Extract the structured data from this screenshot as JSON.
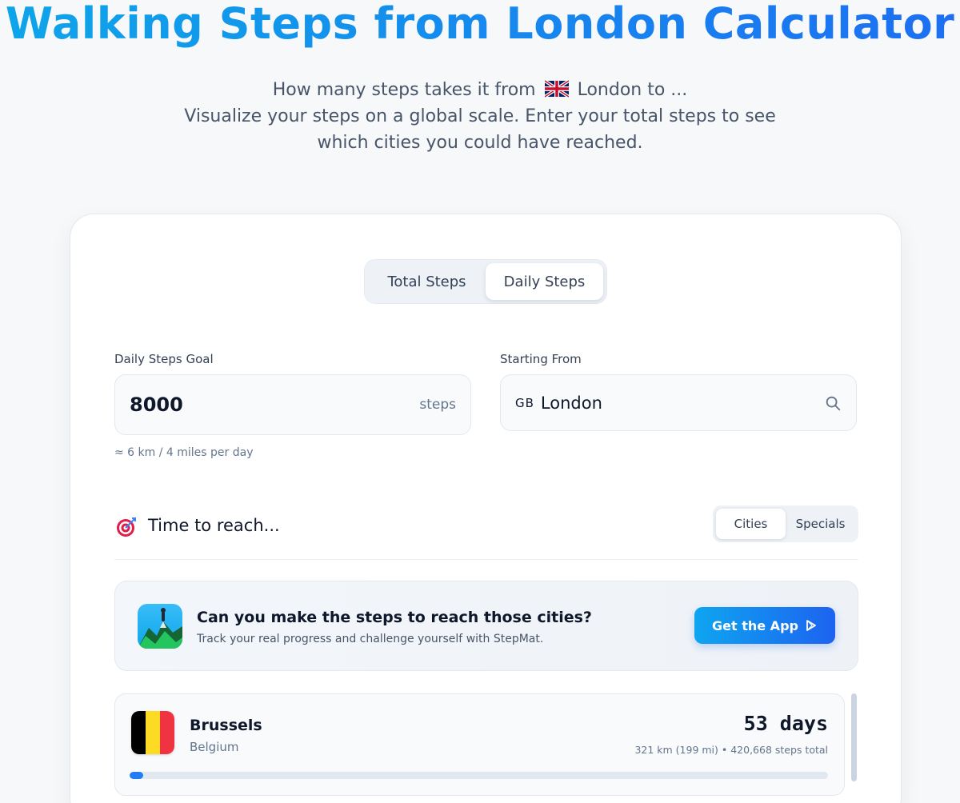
{
  "hero": {
    "title": "Walking Steps from London Calculator",
    "subtitle_line1_pre": "How many steps takes it from",
    "subtitle_line1_post": "London to ...",
    "subtitle_line2": "Visualize your steps on a global scale. Enter your total steps to see which cities you could have reached."
  },
  "mode_toggle": {
    "total_label": "Total Steps",
    "daily_label": "Daily Steps",
    "active": "Daily Steps"
  },
  "daily_goal": {
    "label": "Daily Steps Goal",
    "value": "8000",
    "suffix": "steps",
    "hint": "≈ 6 km / 4 miles per day"
  },
  "starting_from": {
    "label": "Starting From",
    "country_code": "GB",
    "city": "London",
    "icon": "search-icon"
  },
  "reach": {
    "icon": "target-icon",
    "title": "Time to reach...",
    "tabs": {
      "cities": "Cities",
      "specials": "Specials",
      "active": "Cities"
    }
  },
  "promo": {
    "title": "Can you make the steps to reach those cities?",
    "subtitle": "Track your real progress and challenge yourself with StepMat.",
    "button_label": "Get the App",
    "button_icon": "play-icon"
  },
  "destinations": [
    {
      "city": "Brussels",
      "country": "Belgium",
      "days": "53 days",
      "meta": "321 km (199 mi) • 420,668 steps total",
      "progress": 0.02
    }
  ],
  "colors": {
    "accent": "#1d6ff2",
    "accent_light": "#0ea5e9",
    "background": "#f7f8fa"
  }
}
